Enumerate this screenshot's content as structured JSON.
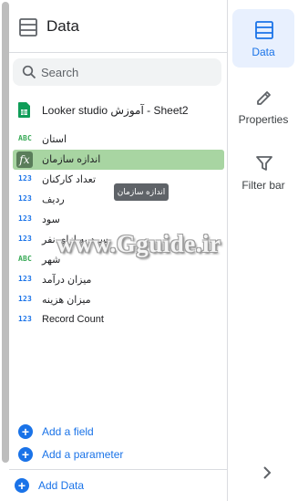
{
  "panel": {
    "title": "Data",
    "search_placeholder": "Search",
    "source_label": "Looker studio آموزش - Sheet2",
    "tooltip": "اندازه سازمان",
    "fields": [
      {
        "type": "ABC",
        "kind": "txt",
        "name": "استان"
      },
      {
        "type": "fx",
        "kind": "fx",
        "name": "اندازه سازمان"
      },
      {
        "type": "123",
        "kind": "num",
        "name": "تعداد کارکنان"
      },
      {
        "type": "123",
        "kind": "num",
        "name": "ردیف"
      },
      {
        "type": "123",
        "kind": "num",
        "name": "سود"
      },
      {
        "type": "123",
        "kind": "num",
        "name": "سود به ازای نفر"
      },
      {
        "type": "ABC",
        "kind": "txt",
        "name": "شهر"
      },
      {
        "type": "123",
        "kind": "num",
        "name": "میزان درآمد"
      },
      {
        "type": "123",
        "kind": "num",
        "name": "میزان هزینه"
      },
      {
        "type": "123",
        "kind": "num",
        "name": "Record Count"
      }
    ],
    "add_field": "Add a field",
    "add_parameter": "Add a parameter",
    "add_data": "Add Data"
  },
  "rail": {
    "data_label": "Data",
    "properties_label": "Properties",
    "filter_label": "Filter bar"
  },
  "watermark": "www.Gguide.ir",
  "colors": {
    "accent": "#1a73e8",
    "active_field": "#a8d5a2",
    "rail_active": "#e8f0fe"
  }
}
